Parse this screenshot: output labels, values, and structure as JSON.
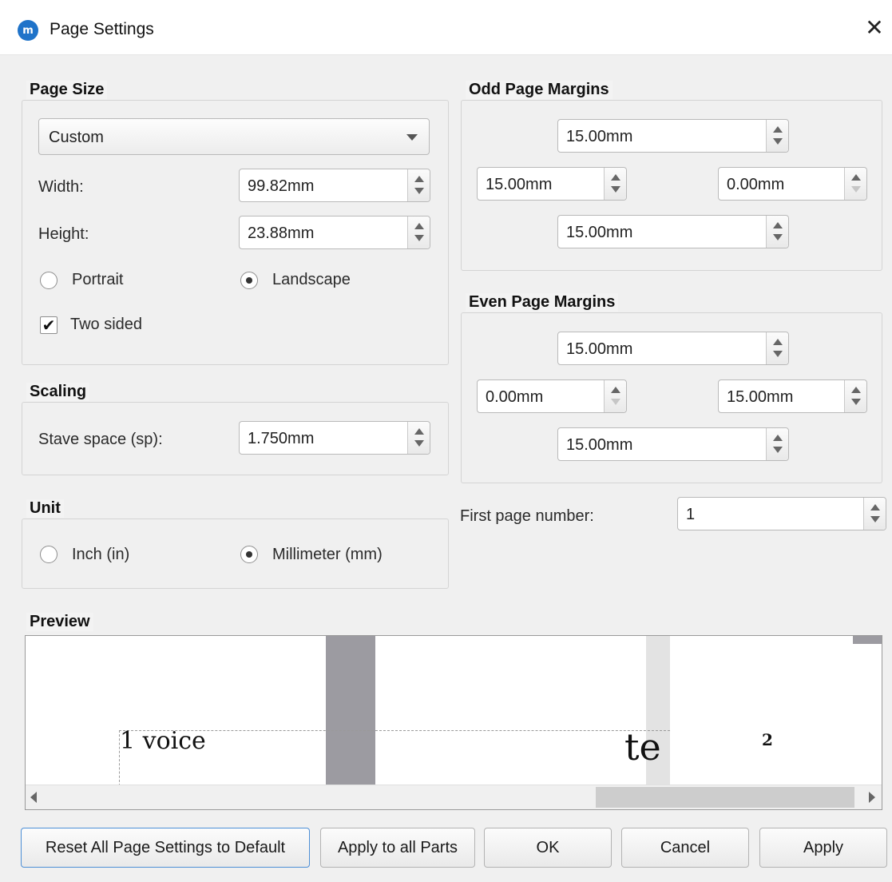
{
  "window": {
    "title": "Page Settings",
    "app_icon": "musescore-logo-icon",
    "close_glyph": "✕"
  },
  "page_size": {
    "group_title": "Page Size",
    "preset_value": "Custom",
    "width_label": "Width:",
    "width_value": "99.82mm",
    "height_label": "Height:",
    "height_value": "23.88mm",
    "portrait_label": "Portrait",
    "landscape_label": "Landscape",
    "orientation_selected": "landscape",
    "two_sided_label": "Two sided",
    "two_sided_checked": true,
    "check_glyph": "✔"
  },
  "scaling": {
    "group_title": "Scaling",
    "stave_space_label": "Stave space (sp):",
    "stave_space_value": "1.750mm"
  },
  "unit": {
    "group_title": "Unit",
    "inch_label": "Inch (in)",
    "mm_label": "Millimeter (mm)",
    "selected": "mm"
  },
  "odd_margins": {
    "group_title": "Odd Page Margins",
    "top": "15.00mm",
    "left": "15.00mm",
    "right": "0.00mm",
    "bottom": "15.00mm"
  },
  "even_margins": {
    "group_title": "Even Page Margins",
    "top": "15.00mm",
    "left": "0.00mm",
    "right": "15.00mm",
    "bottom": "15.00mm"
  },
  "first_page": {
    "label": "First page number:",
    "value": "1"
  },
  "preview": {
    "group_title": "Preview",
    "text_left": "1 voice",
    "text_right": "te",
    "page_number": "2"
  },
  "buttons": {
    "reset": "Reset All Page Settings to Default",
    "apply_all": "Apply to all Parts",
    "ok": "OK",
    "cancel": "Cancel",
    "apply": "Apply"
  },
  "colors": {
    "dialog_bg": "#f0f0f0",
    "accent": "#1f73c9",
    "preview_margin_gray": "#9c9ba1"
  }
}
